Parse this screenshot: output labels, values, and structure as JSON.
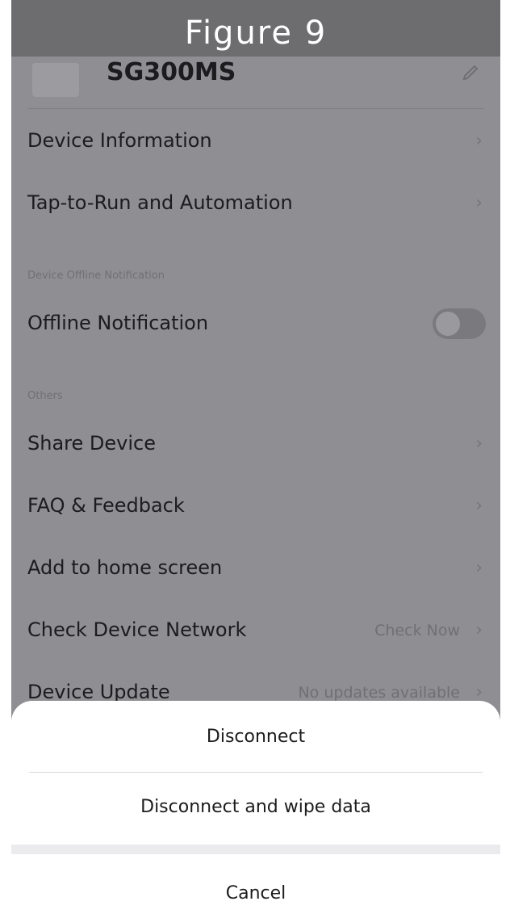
{
  "figure": {
    "title": "Figure 9"
  },
  "device": {
    "name": "SG300MS",
    "thumbnail_icon": "device-thumbnail",
    "edit_icon": "edit-icon"
  },
  "settings": {
    "device_information": "Device Information",
    "tap_to_run": "Tap-to-Run and Automation",
    "offline_section_label": "Device Offline Notification",
    "offline_notification": {
      "label": "Offline Notification",
      "enabled": false
    },
    "others_section_label": "Others",
    "share_device": "Share Device",
    "faq_feedback": "FAQ & Feedback",
    "add_home_screen": "Add to home screen",
    "check_network": {
      "label": "Check Device Network",
      "value": "Check Now"
    },
    "device_update": {
      "label": "Device Update",
      "value": "No updates available"
    }
  },
  "action_sheet": {
    "disconnect": "Disconnect",
    "disconnect_wipe": "Disconnect and wipe data",
    "cancel": "Cancel"
  },
  "colors": {
    "overlay": "#8e8e93",
    "sheet": "#ffffff",
    "banner": "#6d6d70"
  }
}
